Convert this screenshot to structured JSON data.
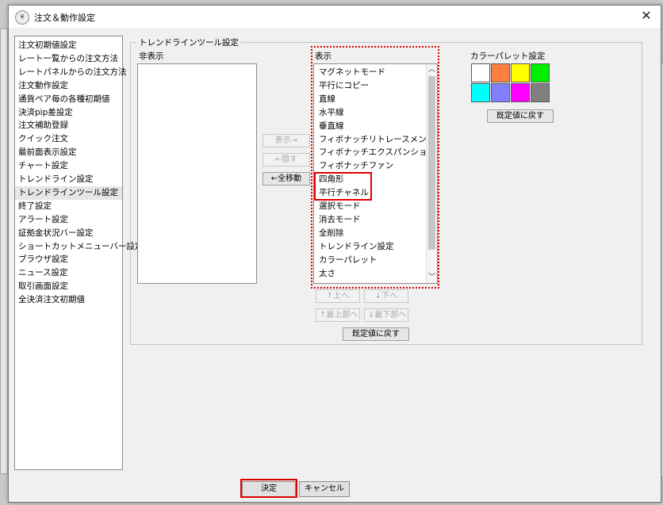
{
  "window": {
    "title": "注文＆動作設定",
    "app_icon": "yen-coin-icon",
    "close_glyph": "✕"
  },
  "sidebar": {
    "items": [
      {
        "label": "注文初期値設定"
      },
      {
        "label": "レート一覧からの注文方法"
      },
      {
        "label": "レートパネルからの注文方法"
      },
      {
        "label": "注文動作設定"
      },
      {
        "label": "通貨ペア毎の各種初期値"
      },
      {
        "label": "決済pip差設定"
      },
      {
        "label": "注文補助登録"
      },
      {
        "label": "クイック注文"
      },
      {
        "label": "最前面表示設定"
      },
      {
        "label": "チャート設定"
      },
      {
        "label": "トレンドライン設定"
      },
      {
        "label": "トレンドラインツール設定",
        "selected": true
      },
      {
        "label": "終了設定"
      },
      {
        "label": "アラート設定"
      },
      {
        "label": "証拠金状況バー設定"
      },
      {
        "label": "ショートカットメニューバー設定"
      },
      {
        "label": "ブラウザ設定"
      },
      {
        "label": "ニュース設定"
      },
      {
        "label": "取引画面設定"
      },
      {
        "label": "全決済注文初期値"
      }
    ]
  },
  "panel": {
    "title": "トレンドラインツール設定",
    "hidden_label": "非表示",
    "shown_label": "表示",
    "shown_items": [
      {
        "label": "マグネットモード"
      },
      {
        "label": "平行にコピー"
      },
      {
        "label": "直線"
      },
      {
        "label": "水平線"
      },
      {
        "label": "垂直線"
      },
      {
        "label": "フィボナッチリトレースメント"
      },
      {
        "label": "フィボナッチエクスパンション"
      },
      {
        "label": "フィボナッチファン"
      },
      {
        "label": "四角形"
      },
      {
        "label": "平行チャネル"
      },
      {
        "label": "選択モード"
      },
      {
        "label": "消去モード"
      },
      {
        "label": "全削除"
      },
      {
        "label": "トレンドライン設定"
      },
      {
        "label": "カラーパレット"
      },
      {
        "label": "太さ"
      }
    ],
    "buttons": {
      "show": "表示→",
      "hide": "←隠す",
      "move_all": "←全移動",
      "up": "↑上へ",
      "down": "↓下へ",
      "top": "↑最上部へ",
      "bottom": "↓最下部へ",
      "reset_list": "既定値に戻す"
    },
    "palette": {
      "label": "カラーパレット設定",
      "colors": [
        "#ffffff",
        "#ff7f3f",
        "#ffff00",
        "#00ee00",
        "#00ffff",
        "#7f7fff",
        "#ff00ff",
        "#808080"
      ],
      "reset": "既定値に戻す"
    }
  },
  "footer": {
    "ok": "決定",
    "cancel": "キャンセル"
  },
  "annotation_color": "#e00000"
}
